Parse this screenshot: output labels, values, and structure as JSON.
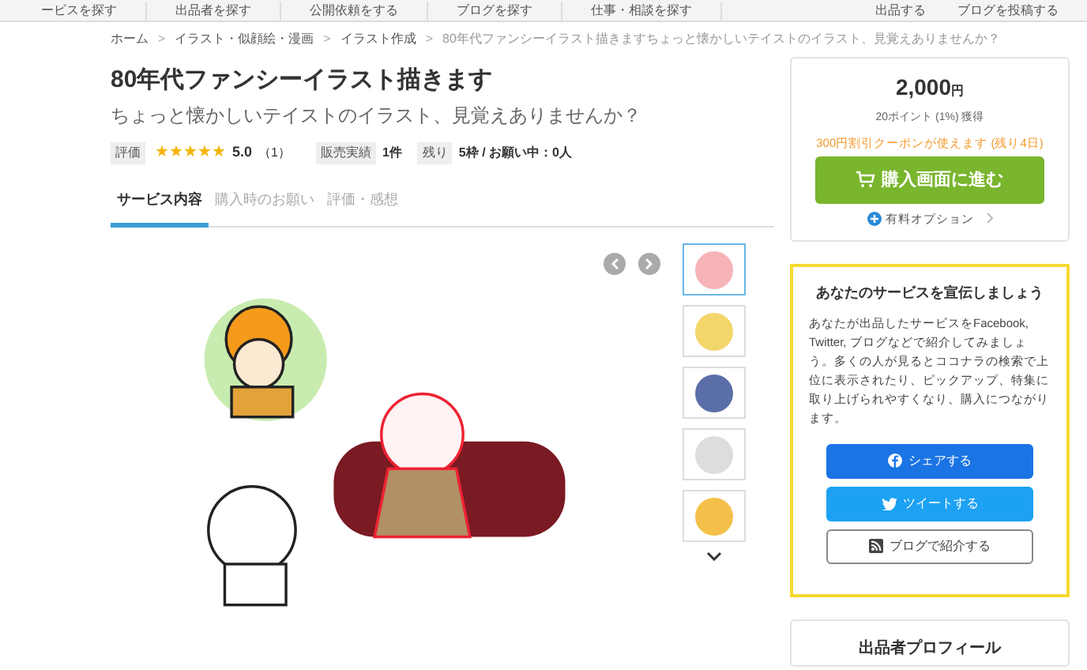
{
  "top_nav": {
    "items": [
      "ービスを探す",
      "出品者を探す",
      "公開依頼をする",
      "ブログを探す",
      "仕事・相談を探す"
    ],
    "actions": [
      "出品する",
      "ブログを投稿する"
    ]
  },
  "breadcrumb_separator": ">",
  "breadcrumb": [
    "ホーム",
    "イラスト・似顔絵・漫画",
    "イラスト作成",
    "80年代ファンシーイラスト描きますちょっと懐かしいテイストのイラスト、見覚えありませんか？"
  ],
  "title": "80年代ファンシーイラスト描きます",
  "subtitle": "ちょっと懐かしいテイストのイラスト、見覚えありませんか？",
  "meta": {
    "rating_label": "評価",
    "stars": 5,
    "rating": "5.0",
    "rating_count": "（1）",
    "sales_label": "販売実績",
    "sales": "1件",
    "remaining_label": "残り",
    "remaining": "5枠 / お願い中：",
    "requesting": "0人"
  },
  "tabs": [
    {
      "label": "サービス内容",
      "selected": true
    },
    {
      "label": "購入時のお願い",
      "selected": false
    },
    {
      "label": "評価・感想",
      "selected": false
    }
  ],
  "gallery": {
    "thumbnails": [
      {
        "selected": true
      },
      {
        "selected": false
      },
      {
        "selected": false
      },
      {
        "selected": false
      },
      {
        "selected": false
      }
    ]
  },
  "purchase": {
    "price": "2,000",
    "currency": "円",
    "points": "20ポイント (1%) 獲得",
    "coupon": "300円割引クーポンが使えます (残り4日)",
    "buy_button": "購入画面に進む",
    "options_link": "有料オプション"
  },
  "promo": {
    "title": "あなたのサービスを宣伝しましょう",
    "body": "あなたが出品したサービスをFacebook, Twitter, ブログなどで紹介してみましょう。多くの人が見るとココナラの検索で上位に表示されたり、ピックアップ、特集に取り上げられやすくなり、購入につながります。",
    "buttons": [
      {
        "kind": "facebook",
        "label": "シェアする"
      },
      {
        "kind": "twitter",
        "label": "ツイートする"
      },
      {
        "kind": "blog",
        "label": "ブログで紹介する"
      }
    ]
  },
  "profile": {
    "title": "出品者プロフィール"
  }
}
